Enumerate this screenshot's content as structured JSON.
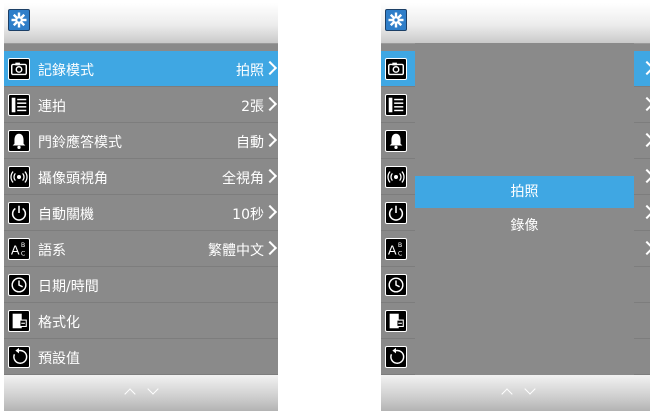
{
  "left_screen": {
    "settings_icon": "gear-icon",
    "menu": [
      {
        "icon": "camera-icon",
        "label": "記錄模式",
        "value": "拍照",
        "selected": true
      },
      {
        "icon": "burst-icon",
        "label": "連拍",
        "value": "2張",
        "selected": false
      },
      {
        "icon": "bell-icon",
        "label": "門鈴應答模式",
        "value": "自動",
        "selected": false
      },
      {
        "icon": "camera-view-icon",
        "label": "攝像頭視角",
        "value": "全視角",
        "selected": false
      },
      {
        "icon": "power-icon",
        "label": "自動關機",
        "value": "10秒",
        "selected": false
      },
      {
        "icon": "language-icon",
        "label": "語系",
        "value": "繁體中文",
        "selected": false
      },
      {
        "icon": "clock-icon",
        "label": "日期/時間",
        "value": "",
        "selected": false
      },
      {
        "icon": "format-icon",
        "label": "格式化",
        "value": "",
        "selected": false
      },
      {
        "icon": "reset-icon",
        "label": "預設值",
        "value": "",
        "selected": false
      }
    ]
  },
  "right_screen": {
    "settings_icon": "gear-icon",
    "popup": {
      "options": [
        {
          "label": "拍照",
          "selected": true
        },
        {
          "label": "錄像",
          "selected": false
        }
      ]
    }
  },
  "colors": {
    "selected_row": "#3fa7e3",
    "panel_gray": "#8a8a8a",
    "gear_blue": "#2f7ec9"
  }
}
